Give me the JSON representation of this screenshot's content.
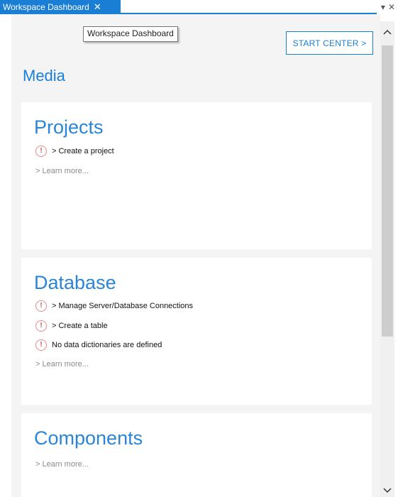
{
  "tab": {
    "title": "Workspace Dashboard",
    "close_glyph": "✕"
  },
  "window_controls": {
    "dropdown_glyph": "▾",
    "close_glyph": "✕"
  },
  "tooltip": {
    "text": "Workspace Dashboard"
  },
  "header": {
    "start_center_label": "START CENTER  >",
    "title": "Media"
  },
  "sections": {
    "projects": {
      "title": "Projects",
      "items": [
        {
          "icon": "warning-icon",
          "glyph": "!",
          "label": "> Create a project"
        }
      ],
      "learn_more": "> Learn more..."
    },
    "database": {
      "title": "Database",
      "items": [
        {
          "icon": "warning-icon",
          "glyph": "!",
          "label": "> Manage Server/Database Connections"
        },
        {
          "icon": "warning-icon",
          "glyph": "!",
          "label": "> Create a table"
        },
        {
          "icon": "warning-icon",
          "glyph": "!",
          "label": "No data dictionaries are defined"
        }
      ],
      "learn_more": "> Learn more..."
    },
    "components": {
      "title": "Components",
      "learn_more": "> Learn more..."
    }
  },
  "scrollbar": {
    "up_glyph": "⌃",
    "down_glyph": "⌄"
  },
  "colors": {
    "accent": "#1a7fd4",
    "warning": "#d9534f",
    "background": "#f4f4f4",
    "card": "#ffffff"
  }
}
